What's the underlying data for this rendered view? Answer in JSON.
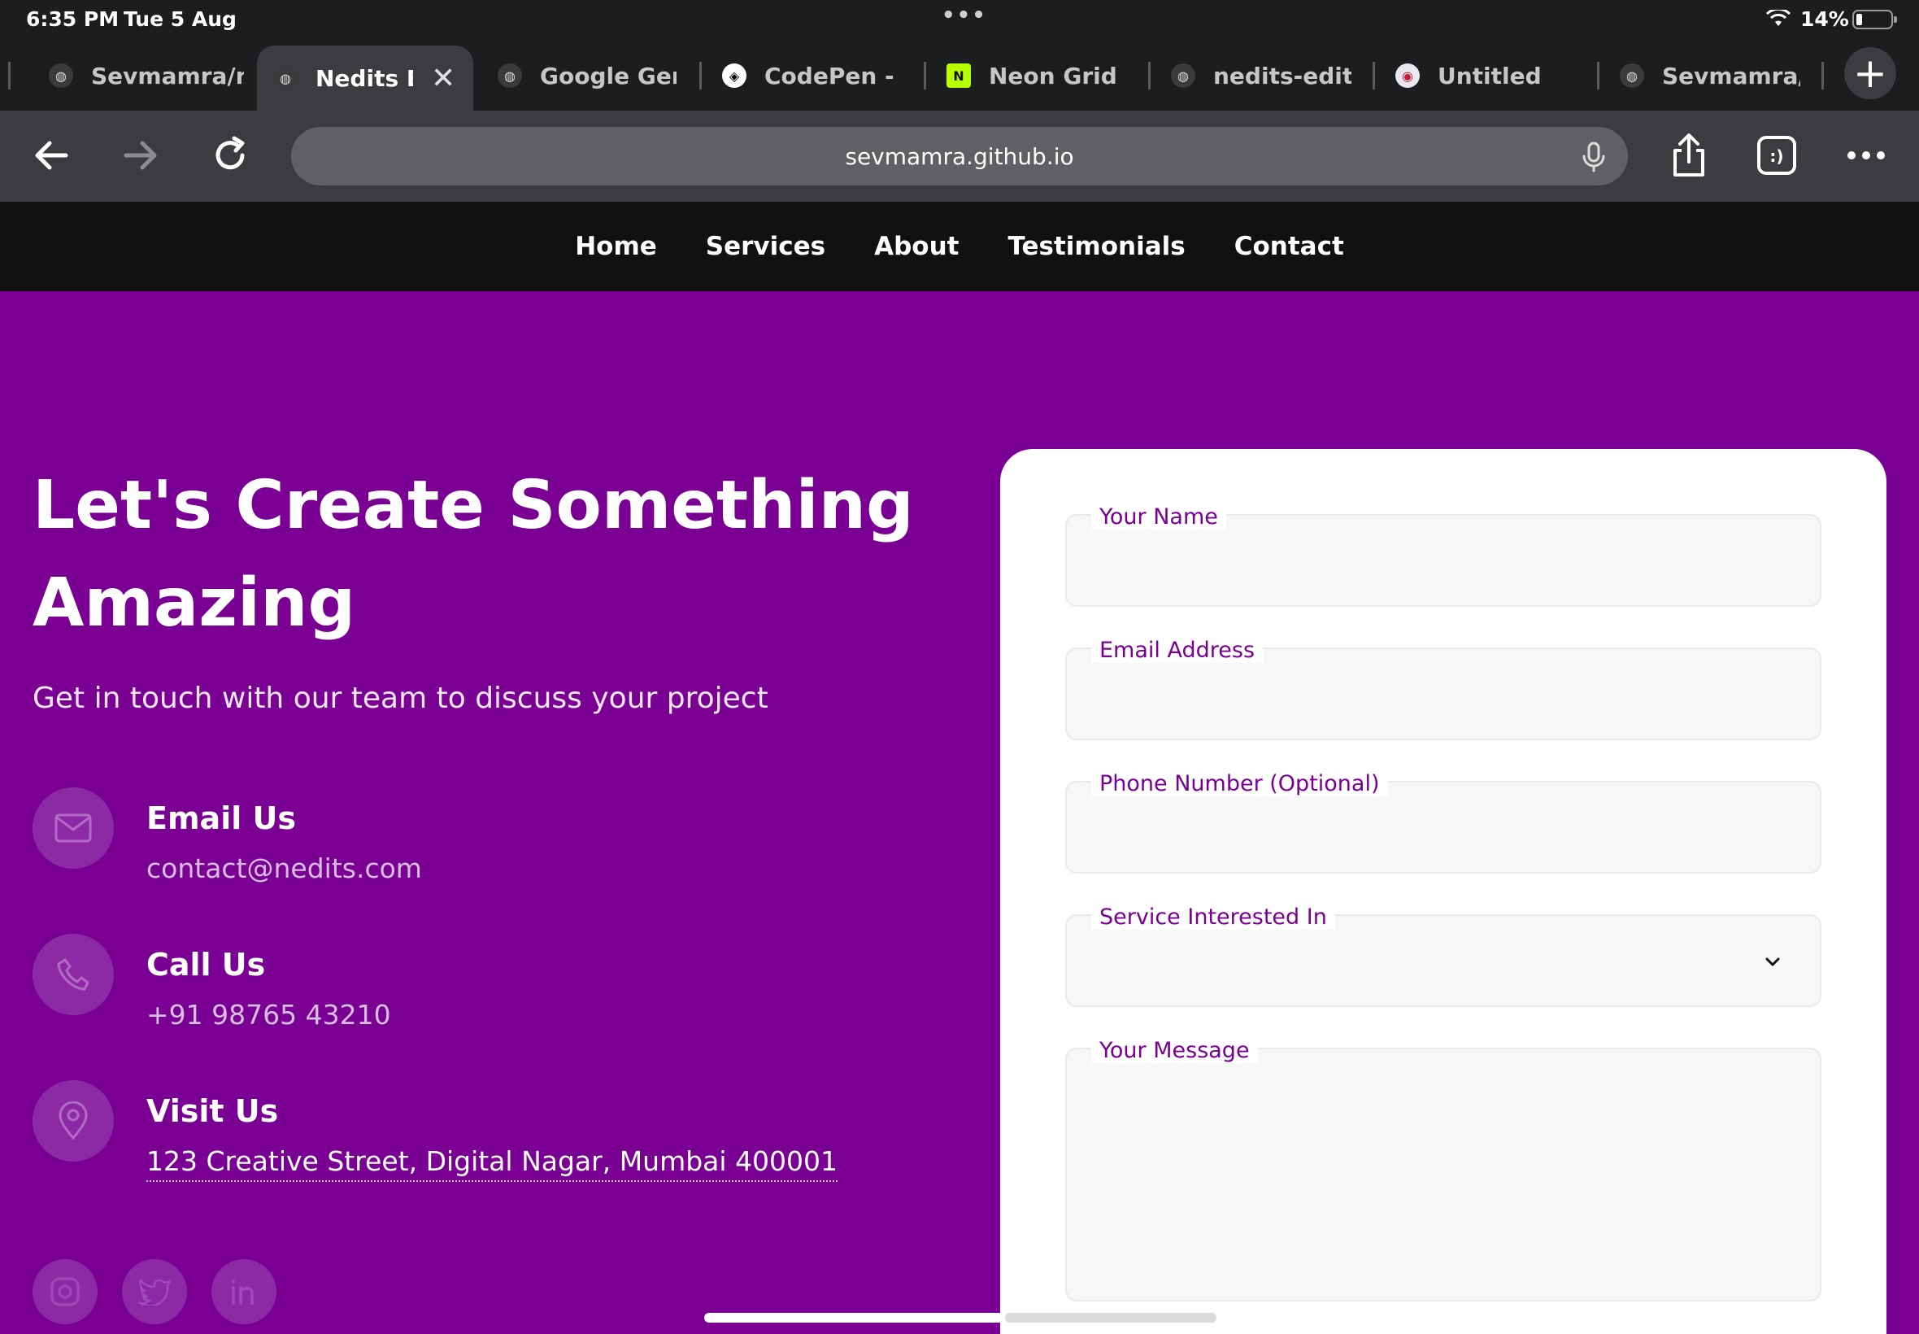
{
  "status_bar": {
    "time": "6:35 PM",
    "date": "Tue 5 Aug",
    "battery": "14%"
  },
  "tabs": [
    {
      "label": "Sevmamra/n",
      "icon": "globe-icon"
    },
    {
      "label": "Nedits E",
      "icon": "globe-icon",
      "active": true
    },
    {
      "label": "Google Gem",
      "icon": "globe-icon"
    },
    {
      "label": "CodePen - A",
      "icon": "codepen-icon"
    },
    {
      "label": "Neon Grid | E",
      "icon": "neon-n-icon"
    },
    {
      "label": "nedits-editio",
      "icon": "globe-icon"
    },
    {
      "label": "Untitled",
      "icon": "shield-badge-icon"
    },
    {
      "label": "Sevmamra/n",
      "icon": "globe-icon"
    }
  ],
  "toolbar": {
    "url": "sevmamra.github.io"
  },
  "nav": {
    "home": "Home",
    "services": "Services",
    "about": "About",
    "testimonials": "Testimonials",
    "contact": "Contact"
  },
  "hero": {
    "title": "Let's Create Something Amazing",
    "subtitle": "Get in touch with our team to discuss your project"
  },
  "contact_info": {
    "email": {
      "title": "Email Us",
      "value": "contact@nedits.com"
    },
    "phone": {
      "title": "Call Us",
      "value": "+91 98765 43210"
    },
    "visit": {
      "title": "Visit Us",
      "value": "123 Creative Street, Digital Nagar, Mumbai 400001"
    }
  },
  "form": {
    "name_label": "Your Name",
    "email_label": "Email Address",
    "phone_label": "Phone Number (Optional)",
    "service_label": "Service Interested In",
    "message_label": "Your Message"
  },
  "colors": {
    "brand": "#7a0094",
    "nav_bg": "#111111",
    "browser_chrome": "#3b3c3f"
  }
}
